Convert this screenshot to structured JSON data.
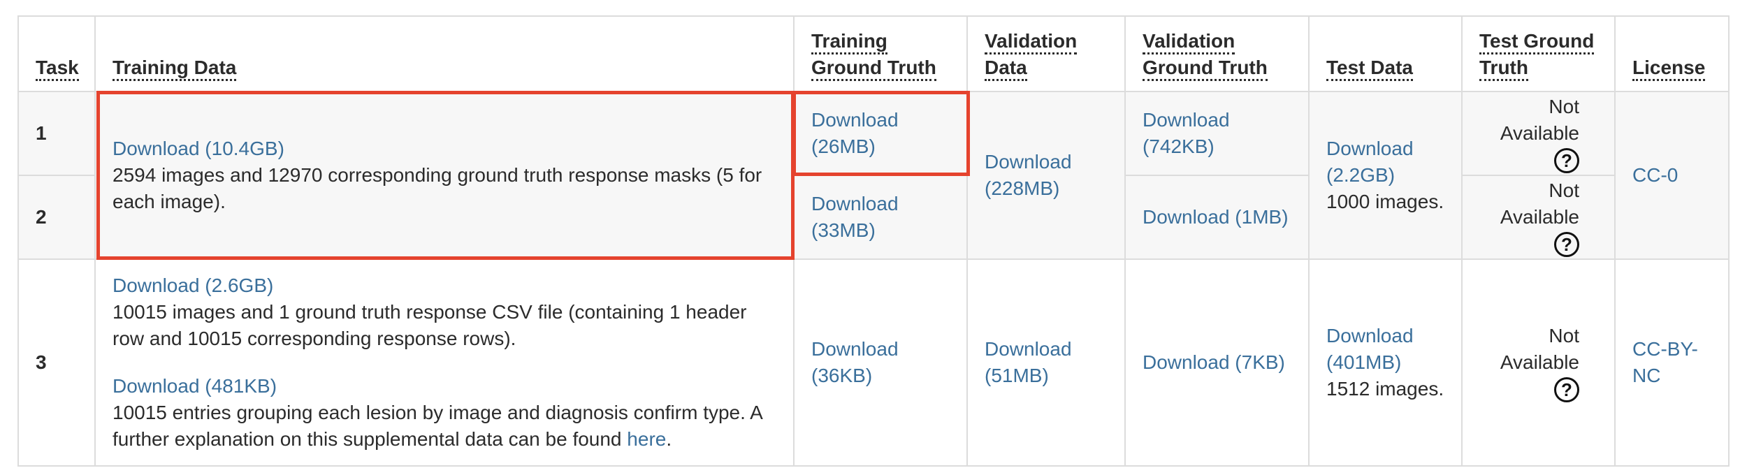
{
  "headers": {
    "task": "Task",
    "training_data": "Training Data",
    "training_gt_l1": "Training",
    "training_gt_l2": "Ground Truth",
    "validation_data_l1": "Validation",
    "validation_data_l2": "Data",
    "validation_gt_l1": "Validation",
    "validation_gt_l2": "Ground Truth",
    "test_data": "Test Data",
    "test_gt_l1": "Test Ground",
    "test_gt_l2": "Truth",
    "license": "License"
  },
  "rows": [
    {
      "task": "1",
      "training_gt_l1": "Download",
      "training_gt_l2": "(26MB)",
      "validation_gt_l1": "Download",
      "validation_gt_l2": "(742KB)",
      "test_gt": "Not Available"
    },
    {
      "task": "2",
      "training_gt_l1": "Download",
      "training_gt_l2": "(33MB)",
      "validation_gt": "Download (1MB)",
      "test_gt": "Not Available"
    },
    {
      "task": "3",
      "training_link1": "Download (2.6GB)",
      "training_desc1": "10015 images and 1 ground truth response CSV file (containing 1 header row and 10015 corresponding response rows).",
      "training_link2": "Download (481KB)",
      "training_desc2_pre": "10015 entries grouping each lesion by image and diagnosis confirm type. A further explanation on this supplemental data can be found ",
      "training_desc2_link": "here",
      "training_desc2_post": ".",
      "training_gt_l1": "Download",
      "training_gt_l2": "(36KB)",
      "validation_data_l1": "Download",
      "validation_data_l2": "(51MB)",
      "validation_gt": "Download (7KB)",
      "test_data_l1": "Download",
      "test_data_l2": "(401MB)",
      "test_data_desc": "1512 images.",
      "test_gt": "Not Available",
      "license_l1": "CC-BY-",
      "license_l2": "NC"
    }
  ],
  "shared_12": {
    "training_link": "Download (10.4GB)",
    "training_desc": "2594 images and 12970 corresponding ground truth response masks (5 for each image).",
    "validation_data_l1": "Download",
    "validation_data_l2": "(228MB)",
    "test_data_l1": "Download",
    "test_data_l2": "(2.2GB)",
    "test_data_desc": "1000 images.",
    "license": "CC-0"
  },
  "help_icon": "?",
  "colors": {
    "link": "#3a6f9b",
    "highlight": "#e5432e",
    "border": "#dcdcdc",
    "shade": "#f7f7f7"
  }
}
